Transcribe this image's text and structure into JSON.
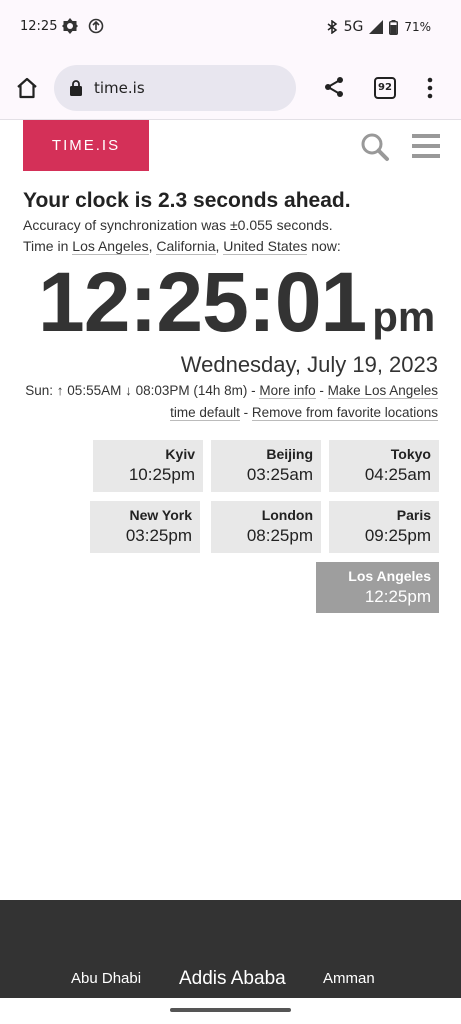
{
  "status_bar": {
    "time": "12:25",
    "network": "5G",
    "battery": "71%"
  },
  "browser": {
    "url": "time.is",
    "tab_count": "92"
  },
  "site": {
    "logo": "TIME.IS",
    "headline": "Your clock is 2.3 seconds ahead.",
    "accuracy": "Accuracy of synchronization was ±0.055 seconds.",
    "time_in_prefix": "Time in ",
    "location_city": "Los Angeles",
    "location_sep1": ", ",
    "location_state": "California",
    "location_sep2": ", ",
    "location_country": "United States",
    "time_in_suffix": " now:",
    "clock_digits": "12:25:01",
    "clock_ampm": "pm",
    "date": "Wednesday, July 19, 2023",
    "sun_text": "Sun: ↑ 05:55AM ↓ 08:03PM (14h 8m) - ",
    "more_info": "More info",
    "sep": " - ",
    "make_default": "Make Los Angeles time default",
    "remove_favorite": "Remove from favorite locations"
  },
  "cities": [
    {
      "name": "Kyiv",
      "time": "10:25pm"
    },
    {
      "name": "Beijing",
      "time": "03:25am"
    },
    {
      "name": "Tokyo",
      "time": "04:25am"
    },
    {
      "name": "New York",
      "time": "03:25pm"
    },
    {
      "name": "London",
      "time": "08:25pm"
    },
    {
      "name": "Paris",
      "time": "09:25pm"
    },
    {
      "name": "Los Angeles",
      "time": "12:25pm"
    }
  ],
  "footer": {
    "links": [
      "Abu Dhabi",
      "Addis Ababa",
      "Amman"
    ]
  },
  "colors": {
    "brand": "#d43058",
    "active_city": "#9e9e9e",
    "footer_bg": "#333333"
  }
}
